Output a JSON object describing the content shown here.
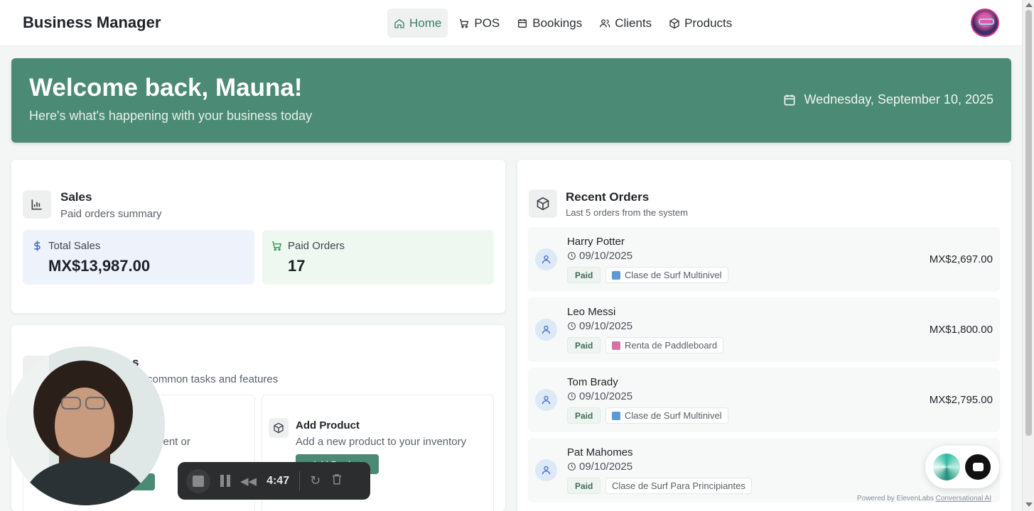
{
  "app": {
    "brand": "Business Manager"
  },
  "nav": {
    "items": [
      {
        "label": "Home",
        "icon": "home-icon",
        "active": true
      },
      {
        "label": "POS",
        "icon": "cart-icon",
        "active": false
      },
      {
        "label": "Bookings",
        "icon": "calendar-icon",
        "active": false
      },
      {
        "label": "Clients",
        "icon": "users-icon",
        "active": false
      },
      {
        "label": "Products",
        "icon": "box-icon",
        "active": false
      }
    ]
  },
  "hero": {
    "title": "Welcome back, Mauna!",
    "subtitle": "Here's what's happening with your business today",
    "date": "Wednesday, September 10, 2025"
  },
  "sales": {
    "title": "Sales",
    "subtitle": "Paid orders summary",
    "total_label": "Total Sales",
    "total_value": "MX$13,987.00",
    "orders_label": "Paid Orders",
    "orders_value": "17"
  },
  "quick_actions": {
    "title_partial": "s",
    "subtitle_partial": "common tasks and features",
    "left_text_partial": "ment or",
    "add_product": {
      "title": "Add Product",
      "desc": "Add a new product to your inventory",
      "button": "Add Product"
    }
  },
  "orders": {
    "title": "Recent Orders",
    "subtitle": "Last 5 orders from the system",
    "items": [
      {
        "name": "Harry Potter",
        "date": "09/10/2025",
        "status": "Paid",
        "product": "Clase de Surf Multinivel",
        "amount": "MX$2,697.00"
      },
      {
        "name": "Leo Messi",
        "date": "09/10/2025",
        "status": "Paid",
        "product": "Renta de Paddleboard",
        "amount": "MX$1,800.00"
      },
      {
        "name": "Tom Brady",
        "date": "09/10/2025",
        "status": "Paid",
        "product": "Clase de Surf Multinivel",
        "amount": "MX$2,795.00"
      },
      {
        "name": "Pat Mahomes",
        "date": "09/10/2025",
        "status": "Paid",
        "product": "Clase de Surf Para Principiantes",
        "amount": ""
      }
    ]
  },
  "recorder": {
    "time": "4:47"
  },
  "widget": {
    "powered_prefix": "Powered by ElevenLabs",
    "powered_link": "Conversational AI"
  },
  "colors": {
    "accent": "#4b8a74",
    "sales_bg": "#eef3fb",
    "orders_bg": "#eef8f0"
  }
}
